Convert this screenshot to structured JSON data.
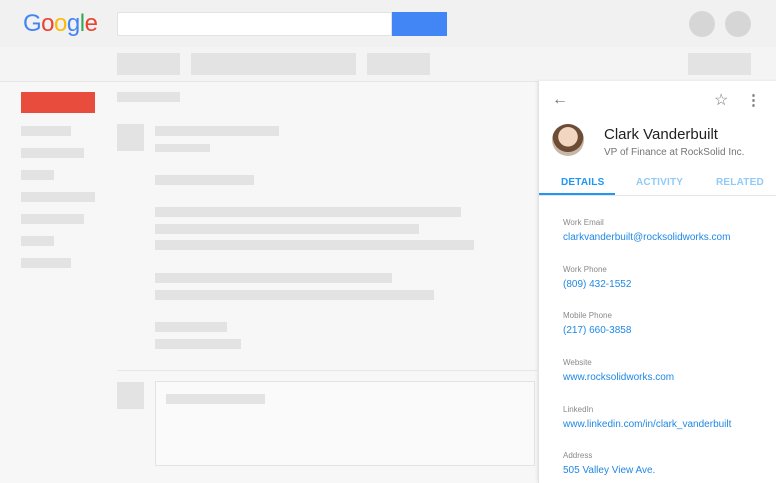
{
  "app": {
    "logo_text": [
      "G",
      "o",
      "o",
      "g",
      "l",
      "e"
    ],
    "logo_colors": [
      "#4285f4",
      "#ea4335",
      "#fbbc05",
      "#4285f4",
      "#34a853",
      "#ea4335"
    ]
  },
  "colors": {
    "search_button": "#4285f4",
    "compose_button": "#e74c3c",
    "link": "#1e88e5",
    "tab_active": "#2196f3"
  },
  "contact": {
    "back_icon": "arrow-left-icon",
    "star_icon": "star-outline-icon",
    "more_icon": "more-vert-icon",
    "name": "Clark Vanderbuilt",
    "title": "VP of Finance at RockSolid Inc.",
    "tabs": [
      {
        "label": "DETAILS",
        "active": true
      },
      {
        "label": "ACTIVITY",
        "active": false
      },
      {
        "label": "RELATED",
        "active": false
      }
    ],
    "fields": [
      {
        "label": "Work Email",
        "value": "clarkvanderbuilt@rocksolidworks.com"
      },
      {
        "label": "Work Phone",
        "value": "(809) 432-1552"
      },
      {
        "label": "Mobile Phone",
        "value": "(217) 660-3858"
      },
      {
        "label": "Website",
        "value": "www.rocksolidworks.com"
      },
      {
        "label": "LinkedIn",
        "value": "www.linkedin.com/in/clark_vanderbuilt"
      },
      {
        "label": "Address",
        "value": "505 Valley View Ave."
      }
    ]
  }
}
